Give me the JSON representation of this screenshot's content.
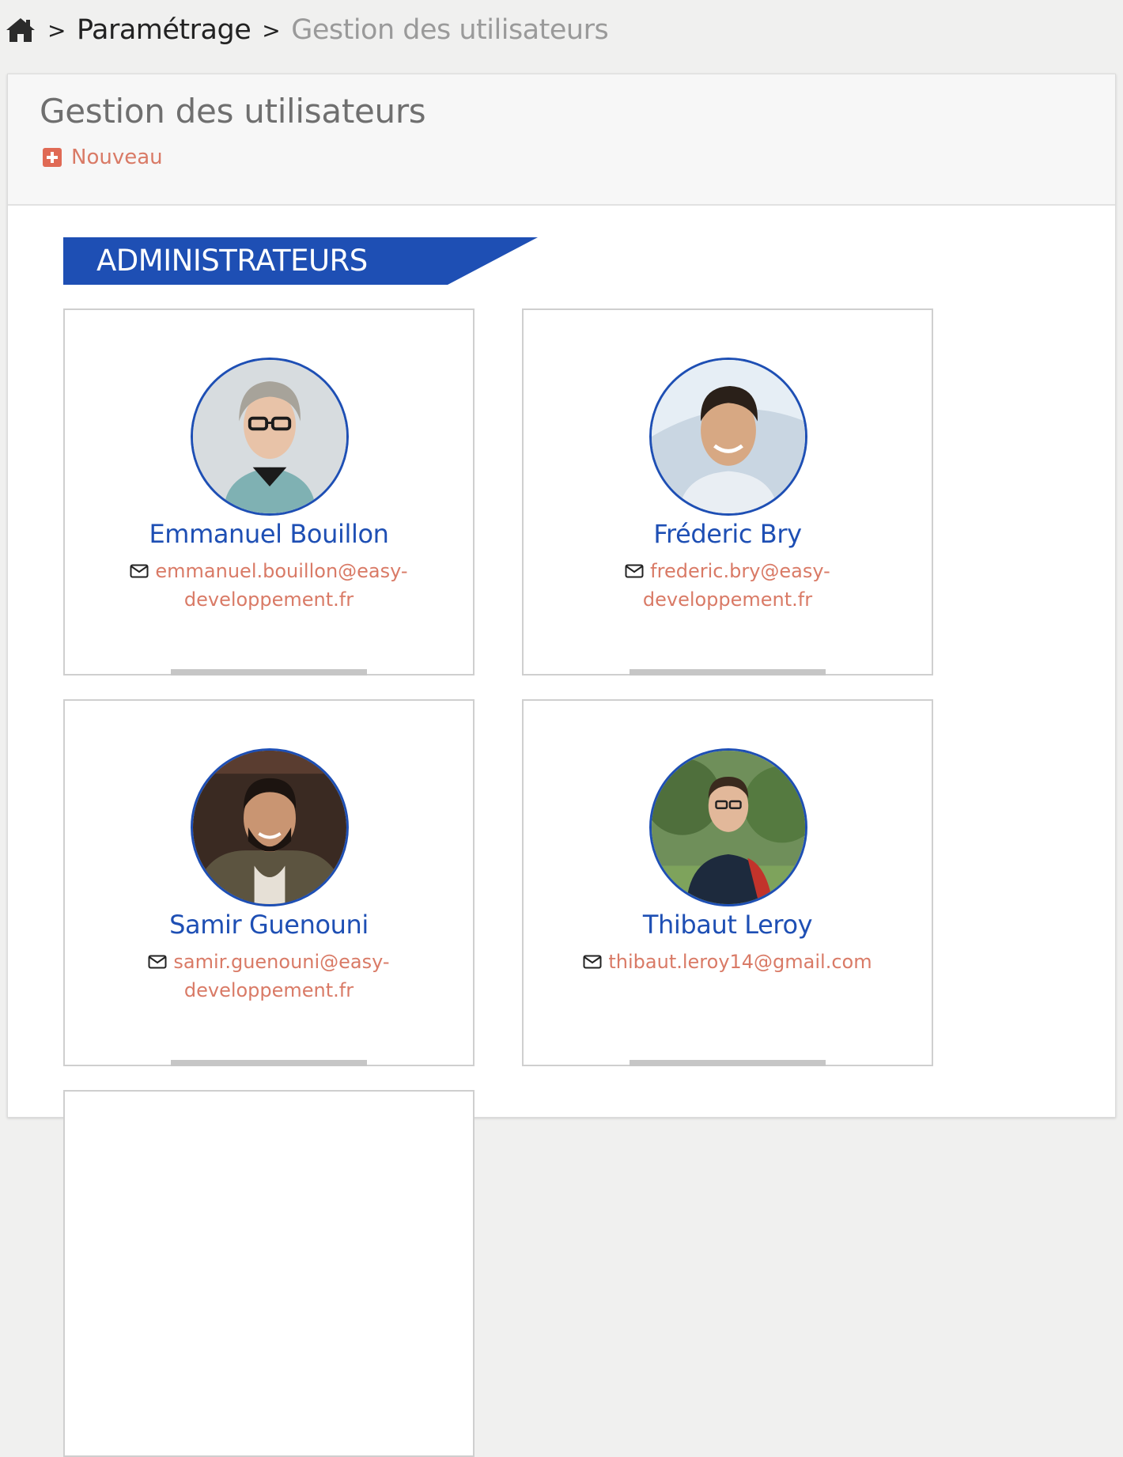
{
  "breadcrumb": {
    "home_icon": "home-icon",
    "items": [
      "Paramétrage",
      "Gestion des utilisateurs"
    ]
  },
  "page": {
    "title": "Gestion des utilisateurs",
    "new_label": "Nouveau",
    "new_icon": "plus-square-icon"
  },
  "section": {
    "title": "ADMINISTRATEURS",
    "color": "#1e4fb4"
  },
  "users": [
    {
      "name": "Emmanuel Bouillon",
      "email_line1": "emmanuel.bouillon@easy-",
      "email_line2": "developpement.fr"
    },
    {
      "name": "Fréderic Bry",
      "email_line1": "frederic.bry@easy-",
      "email_line2": "developpement.fr"
    },
    {
      "name": "Samir Guenouni",
      "email_line1": "samir.guenouni@easy-",
      "email_line2": "developpement.fr"
    },
    {
      "name": "Thibaut Leroy",
      "email_line1": "thibaut.leroy14@gmail.com",
      "email_line2": ""
    }
  ],
  "colors": {
    "accent": "#1e4fb4",
    "link": "#d97a66",
    "new_icon": "#e06a55"
  }
}
